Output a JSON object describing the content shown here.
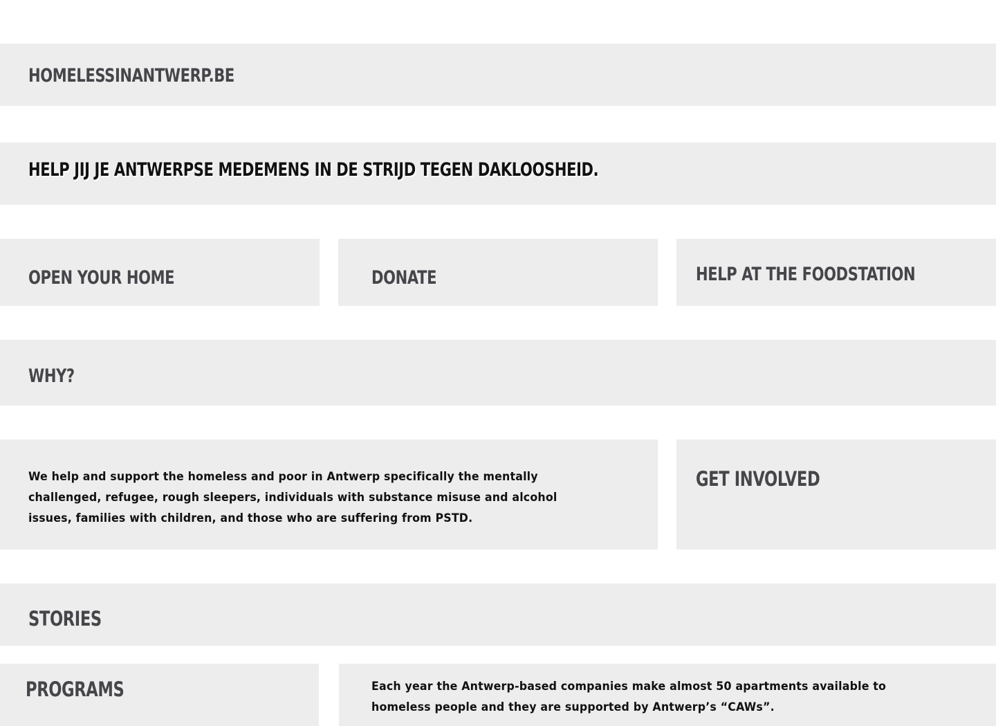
{
  "site": {
    "title": "HOMELESSINANTWERP.BE"
  },
  "hero": {
    "tagline": "HELP JIJ JE ANTWERPSE MEDEMENS IN DE STRIJD TEGEN DAKLOOSHEID."
  },
  "actions": [
    {
      "label": "OPEN YOUR HOME"
    },
    {
      "label": "DONATE"
    },
    {
      "label": "HELP AT THE FOODSTATION"
    }
  ],
  "why": {
    "heading": "WHY?",
    "text": "We help and support the homeless and poor in Antwerp specifically the mentally challenged, refugee,   rough sleepers, individuals with substance misuse and alcohol issues, families with children, and those who are suffering from PSTD."
  },
  "get_involved": {
    "label": "GET INVOLVED"
  },
  "stories": {
    "heading": "STORIES"
  },
  "programs": {
    "heading": "PROGRAMS",
    "text": "Each year the Antwerp-based companies make almost 50 apartments available to homeless people and they are supported by Antwerp’s “CAWs”."
  }
}
